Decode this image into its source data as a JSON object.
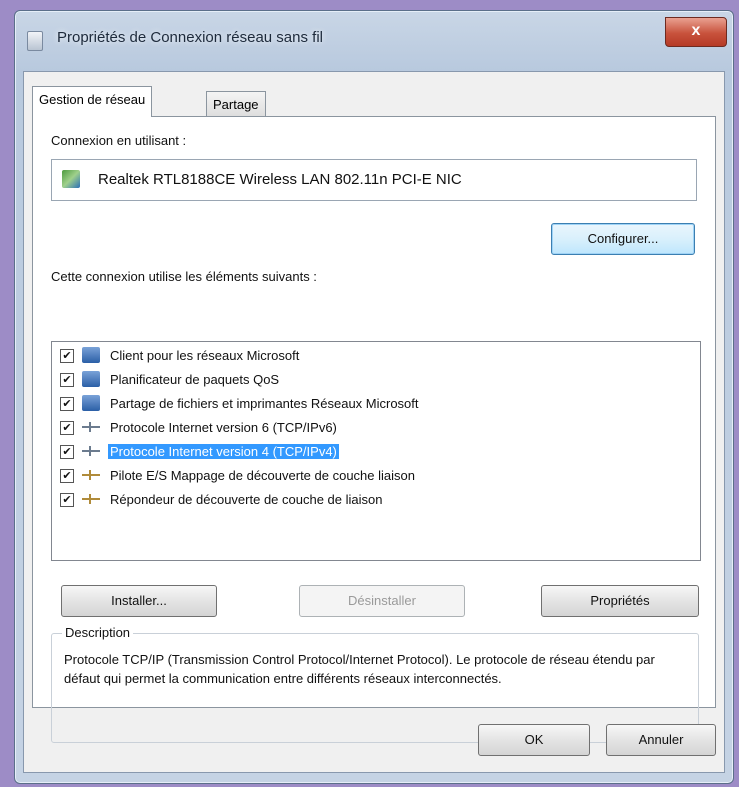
{
  "window": {
    "title": "Propriétés de Connexion réseau sans fil",
    "close_label": "x"
  },
  "tabs": [
    {
      "label": "Gestion de réseau",
      "active": true
    },
    {
      "label": "Partage",
      "active": false
    }
  ],
  "connect_using": {
    "label": "Connexion en utilisant :",
    "adapter": "Realtek RTL8188CE Wireless LAN 802.11n PCI-E NIC",
    "configure_button": "Configurer..."
  },
  "items": {
    "label": "Cette connexion utilise les éléments suivants :",
    "list": [
      {
        "checked": true,
        "icon": "network-client-icon",
        "label": "Client pour les réseaux Microsoft"
      },
      {
        "checked": true,
        "icon": "network-client-icon",
        "label": "Planificateur de paquets QoS"
      },
      {
        "checked": true,
        "icon": "network-client-icon",
        "label": "Partage de fichiers et imprimantes Réseaux Microsoft"
      },
      {
        "checked": true,
        "icon": "protocol-icon",
        "label": "Protocole Internet version 6 (TCP/IPv6)"
      },
      {
        "checked": true,
        "icon": "protocol-icon",
        "label": "Protocole Internet version 4 (TCP/IPv4)",
        "selected": true
      },
      {
        "checked": true,
        "icon": "protocol-icon",
        "label": "Pilote E/S Mappage de découverte de couche liaison"
      },
      {
        "checked": true,
        "icon": "protocol-icon",
        "label": "Répondeur de découverte de couche de liaison"
      }
    ],
    "check_mark": "✔"
  },
  "buttons": {
    "install": "Installer...",
    "uninstall": "Désinstaller",
    "properties": "Propriétés",
    "ok": "OK",
    "cancel": "Annuler"
  },
  "description": {
    "legend": "Description",
    "text": "Protocole TCP/IP (Transmission Control Protocol/Internet Protocol). Le protocole de réseau étendu par défaut qui permet la communication entre différents réseaux interconnectés."
  },
  "colors": {
    "selection": "#3399ff",
    "close_button": "#c8523c",
    "background": "#9d8cc6"
  }
}
